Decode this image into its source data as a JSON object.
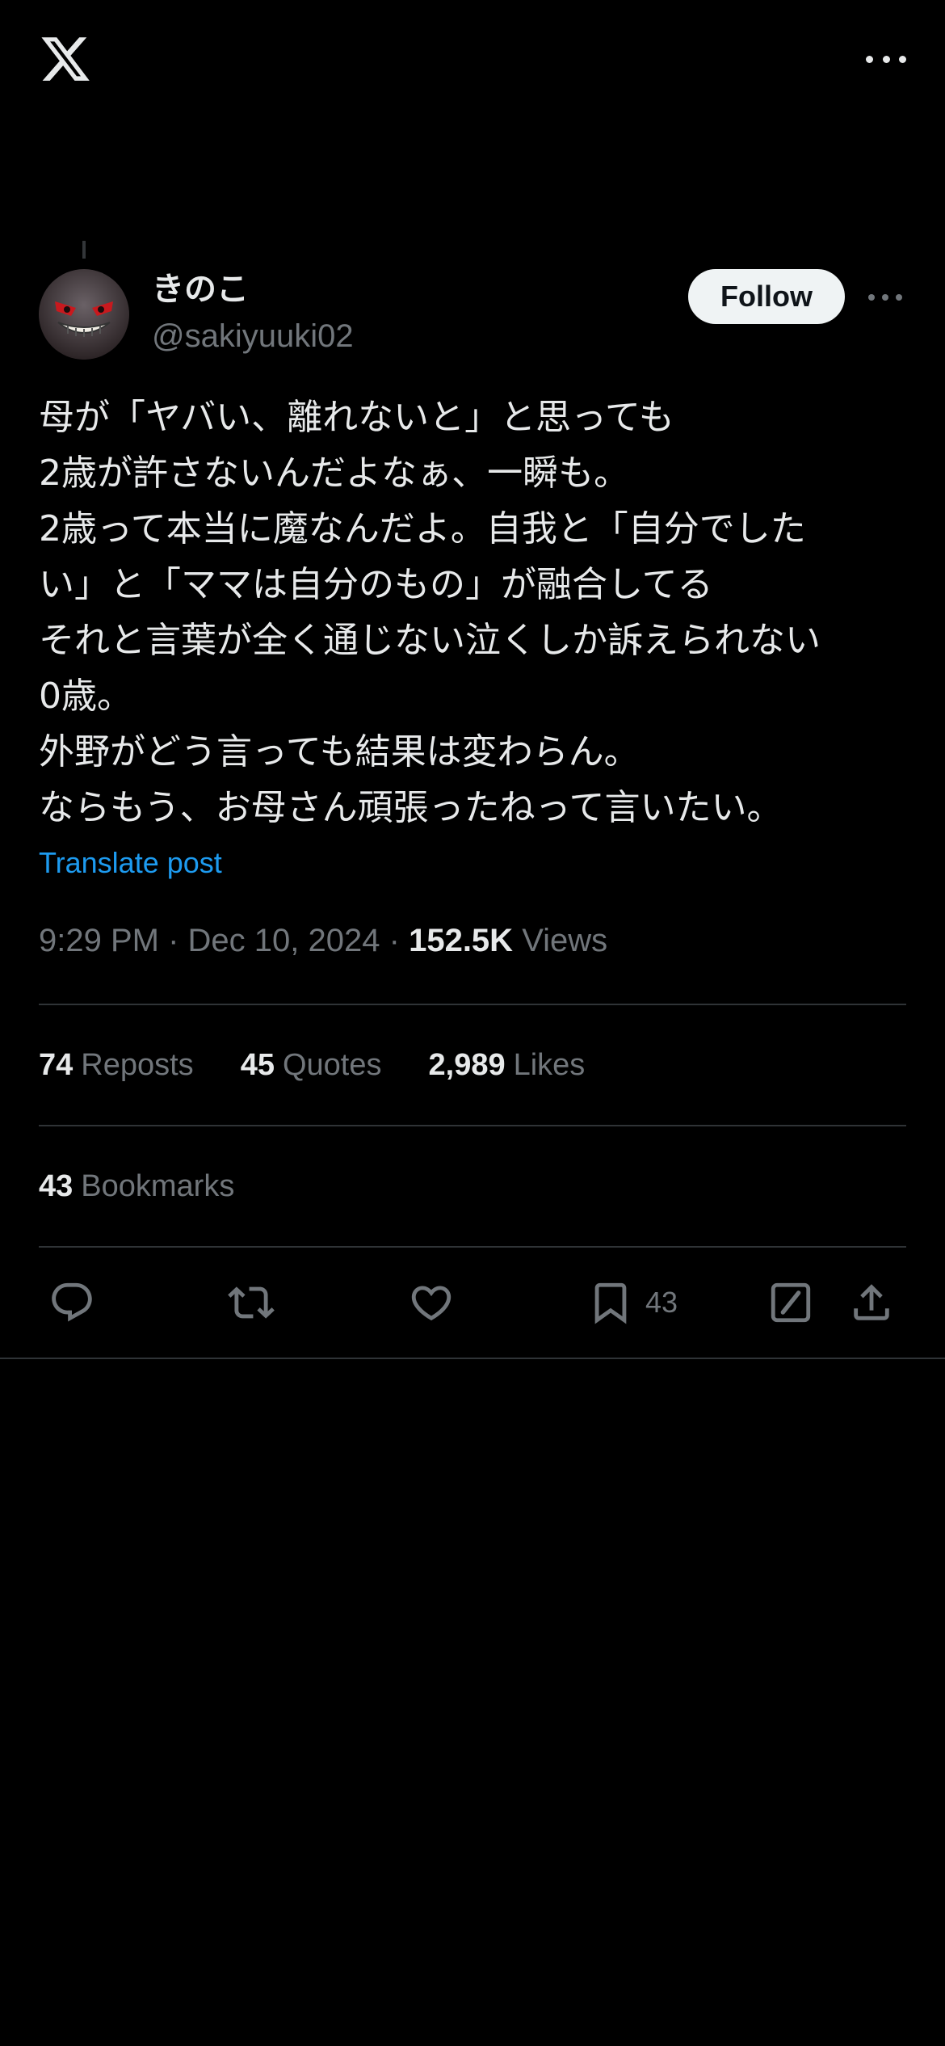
{
  "header": {
    "logo_icon": "x-logo-icon",
    "more_icon": "more-horizontal-icon"
  },
  "post": {
    "author": {
      "display_name": "きのこ",
      "handle": "@sakiyuuki02",
      "avatar_icon": "avatar-image"
    },
    "follow_label": "Follow",
    "text": "母が「ヤバい、離れないと」と思っても\n2歳が許さないんだよなぁ、一瞬も。\n2歳って本当に魔なんだよ。自我と「自分でした\nい」と「ママは自分のもの」が融合してる\nそれと言葉が全く通じない泣くしか訴えられない\n0歳。\n外野がどう言っても結果は変わらん。\nならもう、お母さん頑張ったねって言いたい。",
    "translate_label": "Translate post",
    "time": "9:29 PM",
    "date": "Dec 10, 2024",
    "separator": "·",
    "views_count": "152.5K",
    "views_label": "Views"
  },
  "stats": {
    "reposts": {
      "count": "74",
      "label": "Reposts"
    },
    "quotes": {
      "count": "45",
      "label": "Quotes"
    },
    "likes": {
      "count": "2,989",
      "label": "Likes"
    },
    "bookmarks": {
      "count": "43",
      "label": "Bookmarks"
    }
  },
  "actions": {
    "reply_icon": "reply-icon",
    "repost_icon": "repost-icon",
    "like_icon": "heart-icon",
    "bookmark_icon": "bookmark-icon",
    "bookmark_count": "43",
    "grok_icon": "grok-icon",
    "share_icon": "share-icon"
  },
  "colors": {
    "background": "#000000",
    "text_primary": "#e7e9ea",
    "text_secondary": "#71767b",
    "link": "#1d9bf0",
    "divider": "#2f3336",
    "follow_bg": "#eff3f4"
  }
}
